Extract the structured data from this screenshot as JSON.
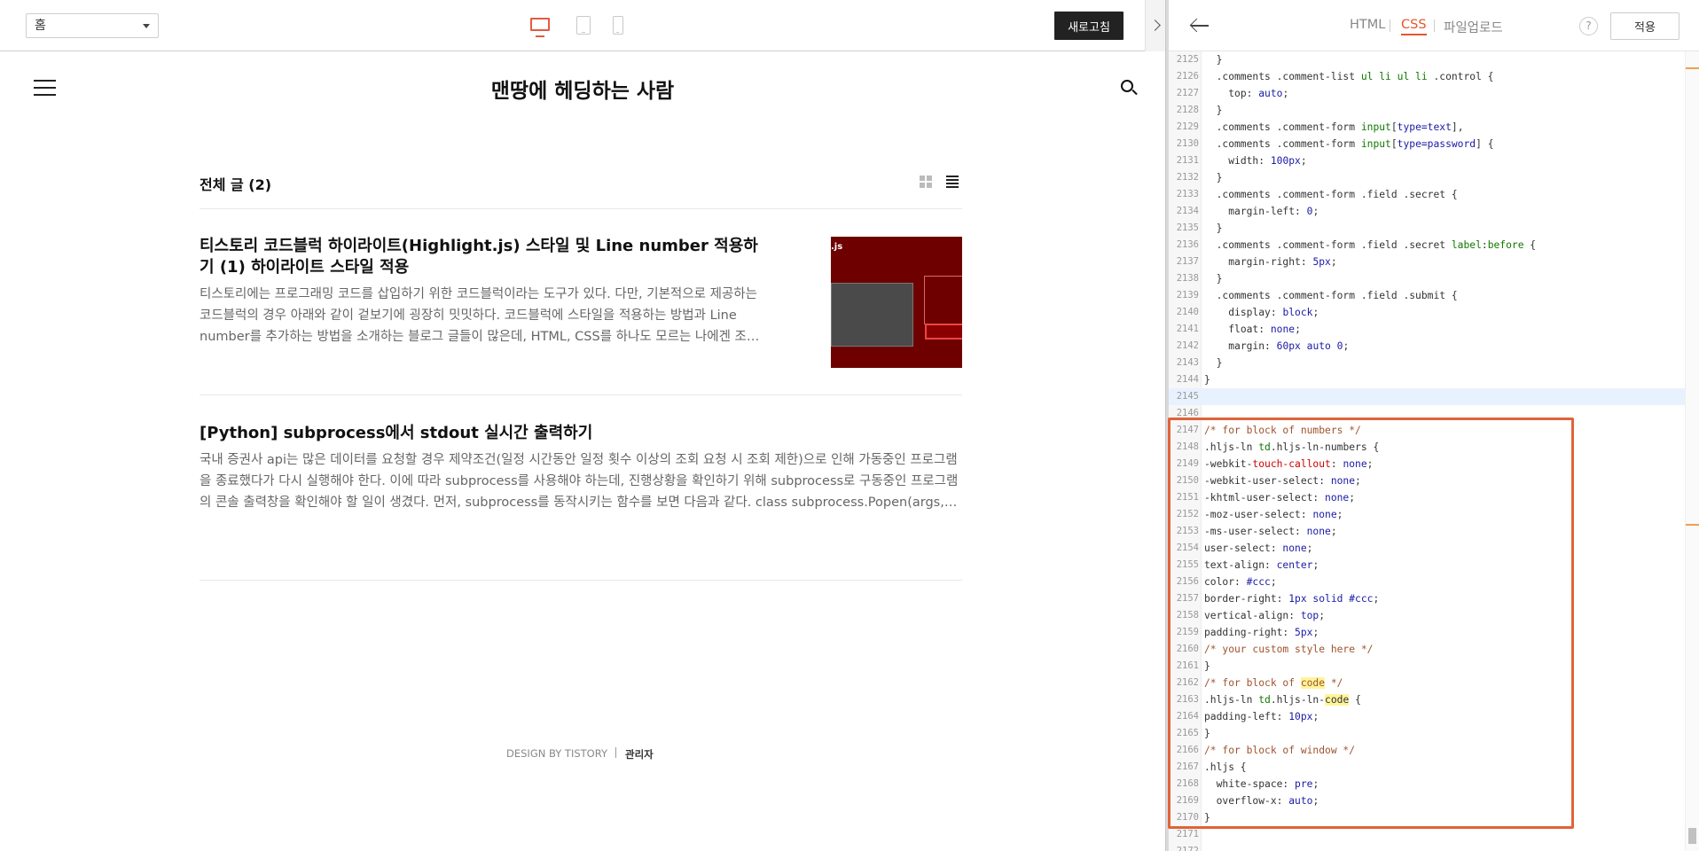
{
  "preview": {
    "page_select": "홈",
    "refresh_label": "새로고침"
  },
  "blog": {
    "title": "맨땅에 헤딩하는 사람",
    "list_title": "전체 글 (2)",
    "posts": [
      {
        "title": "티스토리 코드블럭 하이라이트(Highlight.js) 스타일 및 Line number 적용하기 (1) 하이라이트 스타일 적용",
        "excerpt": "티스토리에는 프로그래밍 코드를 삽입하기 위한 코드블럭이라는 도구가 있다. 다만, 기본적으로 제공하는 코드블럭의 경우 아래와 같이 겉보기에 굉장히 밋밋하다. 코드블럭에 스타일을 적용하는 방법과 Line number를 추가하는 방법을 소개하는 블로그 글들이 많은데, HTML, CSS를 하나도 모르는 나에겐 조…",
        "thumb_text": ".js"
      },
      {
        "title": "[Python] subprocess에서 stdout 실시간 출력하기",
        "excerpt": "국내 증권사 api는 많은 데이터를 요청할 경우 제약조건(일정 시간동안 일정 횟수 이상의 조회 요청 시 조회 제한)으로 인해 가동중인 프로그램을 종료했다가 다시 실행해야 한다. 이에 따라 subprocess를 사용해야 하는데, 진행상황을 확인하기 위해 subprocess로 구동중인 프로그램의 콘솔 출력창을 확인해야 할 일이 생겼다. 먼저, subprocess를 동작시키는 함수를 보면 다음과 같다. class subprocess.Popen(args,…"
      }
    ],
    "footer_design": "DESIGN BY TISTORY",
    "footer_admin": "관리자"
  },
  "editor": {
    "tabs": [
      "HTML",
      "CSS",
      "파일업로드"
    ],
    "active_tab": "CSS",
    "help_label": "?",
    "apply_label": "적용",
    "accent": "#e3572c",
    "lines": [
      {
        "n": "2125",
        "html": "  }"
      },
      {
        "n": "2126",
        "html": "  .comments .comment-list <span class='c-tag'>ul li ul li</span> .control {"
      },
      {
        "n": "2127",
        "html": "    <span class='c-prop'>top</span>: <span class='c-val'>auto</span>;"
      },
      {
        "n": "2128",
        "html": "  }"
      },
      {
        "n": "2129",
        "html": "  .comments .comment-form <span class='c-tag'>input</span>[<span class='c-attr'>type=text</span>],"
      },
      {
        "n": "2130",
        "html": "  .comments .comment-form <span class='c-tag'>input</span>[<span class='c-attr'>type=password</span>] {"
      },
      {
        "n": "2131",
        "html": "    <span class='c-prop'>width</span>: <span class='c-val'>100px</span>;"
      },
      {
        "n": "2132",
        "html": "  }"
      },
      {
        "n": "2133",
        "html": "  .comments .comment-form .field .secret {"
      },
      {
        "n": "2134",
        "html": "    <span class='c-prop'>margin-left</span>: <span class='c-val'>0</span>;"
      },
      {
        "n": "2135",
        "html": "  }"
      },
      {
        "n": "2136",
        "html": "  .comments .comment-form .field .secret <span class='c-tag'>label</span>:<span class='c-tag'>before</span> {"
      },
      {
        "n": "2137",
        "html": "    <span class='c-prop'>margin-right</span>: <span class='c-val'>5px</span>;"
      },
      {
        "n": "2138",
        "html": "  }"
      },
      {
        "n": "2139",
        "html": "  .comments .comment-form .field .submit {"
      },
      {
        "n": "2140",
        "html": "    <span class='c-prop'>display</span>: <span class='c-val'>block</span>;"
      },
      {
        "n": "2141",
        "html": "    <span class='c-prop'>float</span>: <span class='c-val'>none</span>;"
      },
      {
        "n": "2142",
        "html": "    <span class='c-prop'>margin</span>: <span class='c-val'>60px auto 0</span>;"
      },
      {
        "n": "2143",
        "html": "  }"
      },
      {
        "n": "2144",
        "html": "}"
      },
      {
        "n": "2145",
        "html": "",
        "active": true
      },
      {
        "n": "2146",
        "html": ""
      },
      {
        "n": "2147",
        "html": "<span class='c-cmt'>/* for block of numbers */</span>"
      },
      {
        "n": "2148",
        "html": ".hljs-ln <span class='c-tag'>td</span>.hljs-ln-numbers {"
      },
      {
        "n": "2149",
        "html": "-webkit-<span class='c-neg'>touch-callout</span>: <span class='c-val'>none</span>;"
      },
      {
        "n": "2150",
        "html": "-webkit-user-select: <span class='c-val'>none</span>;"
      },
      {
        "n": "2151",
        "html": "-khtml-user-select: <span class='c-val'>none</span>;"
      },
      {
        "n": "2152",
        "html": "-moz-user-select: <span class='c-val'>none</span>;"
      },
      {
        "n": "2153",
        "html": "-ms-user-select: <span class='c-val'>none</span>;"
      },
      {
        "n": "2154",
        "html": "user-select: <span class='c-val'>none</span>;"
      },
      {
        "n": "2155",
        "html": "text-align: <span class='c-val'>center</span>;"
      },
      {
        "n": "2156",
        "html": "color: <span class='c-val'>#ccc</span>;"
      },
      {
        "n": "2157",
        "html": "border-right: <span class='c-val'>1px solid #ccc</span>;"
      },
      {
        "n": "2158",
        "html": "vertical-align: <span class='c-val'>top</span>;"
      },
      {
        "n": "2159",
        "html": "padding-right: <span class='c-val'>5px</span>;"
      },
      {
        "n": "2160",
        "html": "<span class='c-cmt'>/* your custom style here */</span>"
      },
      {
        "n": "2161",
        "html": "}"
      },
      {
        "n": "2162",
        "html": "<span class='c-cmt'>/* for block of <span class='c-hl'>code</span> */</span>"
      },
      {
        "n": "2163",
        "html": ".hljs-ln <span class='c-tag'>td</span>.hljs-ln-<span class='c-hl'>code</span> {"
      },
      {
        "n": "2164",
        "html": "padding-left: <span class='c-val'>10px</span>;"
      },
      {
        "n": "2165",
        "html": "}"
      },
      {
        "n": "2166",
        "html": "<span class='c-cmt'>/* for block of window */</span>"
      },
      {
        "n": "2167",
        "html": ".hljs {"
      },
      {
        "n": "2168",
        "html": "  white-space: <span class='c-val'>pre</span>;"
      },
      {
        "n": "2169",
        "html": "  overflow-x: <span class='c-val'>auto</span>;"
      },
      {
        "n": "2170",
        "html": "}"
      },
      {
        "n": "2171",
        "html": ""
      },
      {
        "n": "2172",
        "html": ""
      }
    ]
  }
}
